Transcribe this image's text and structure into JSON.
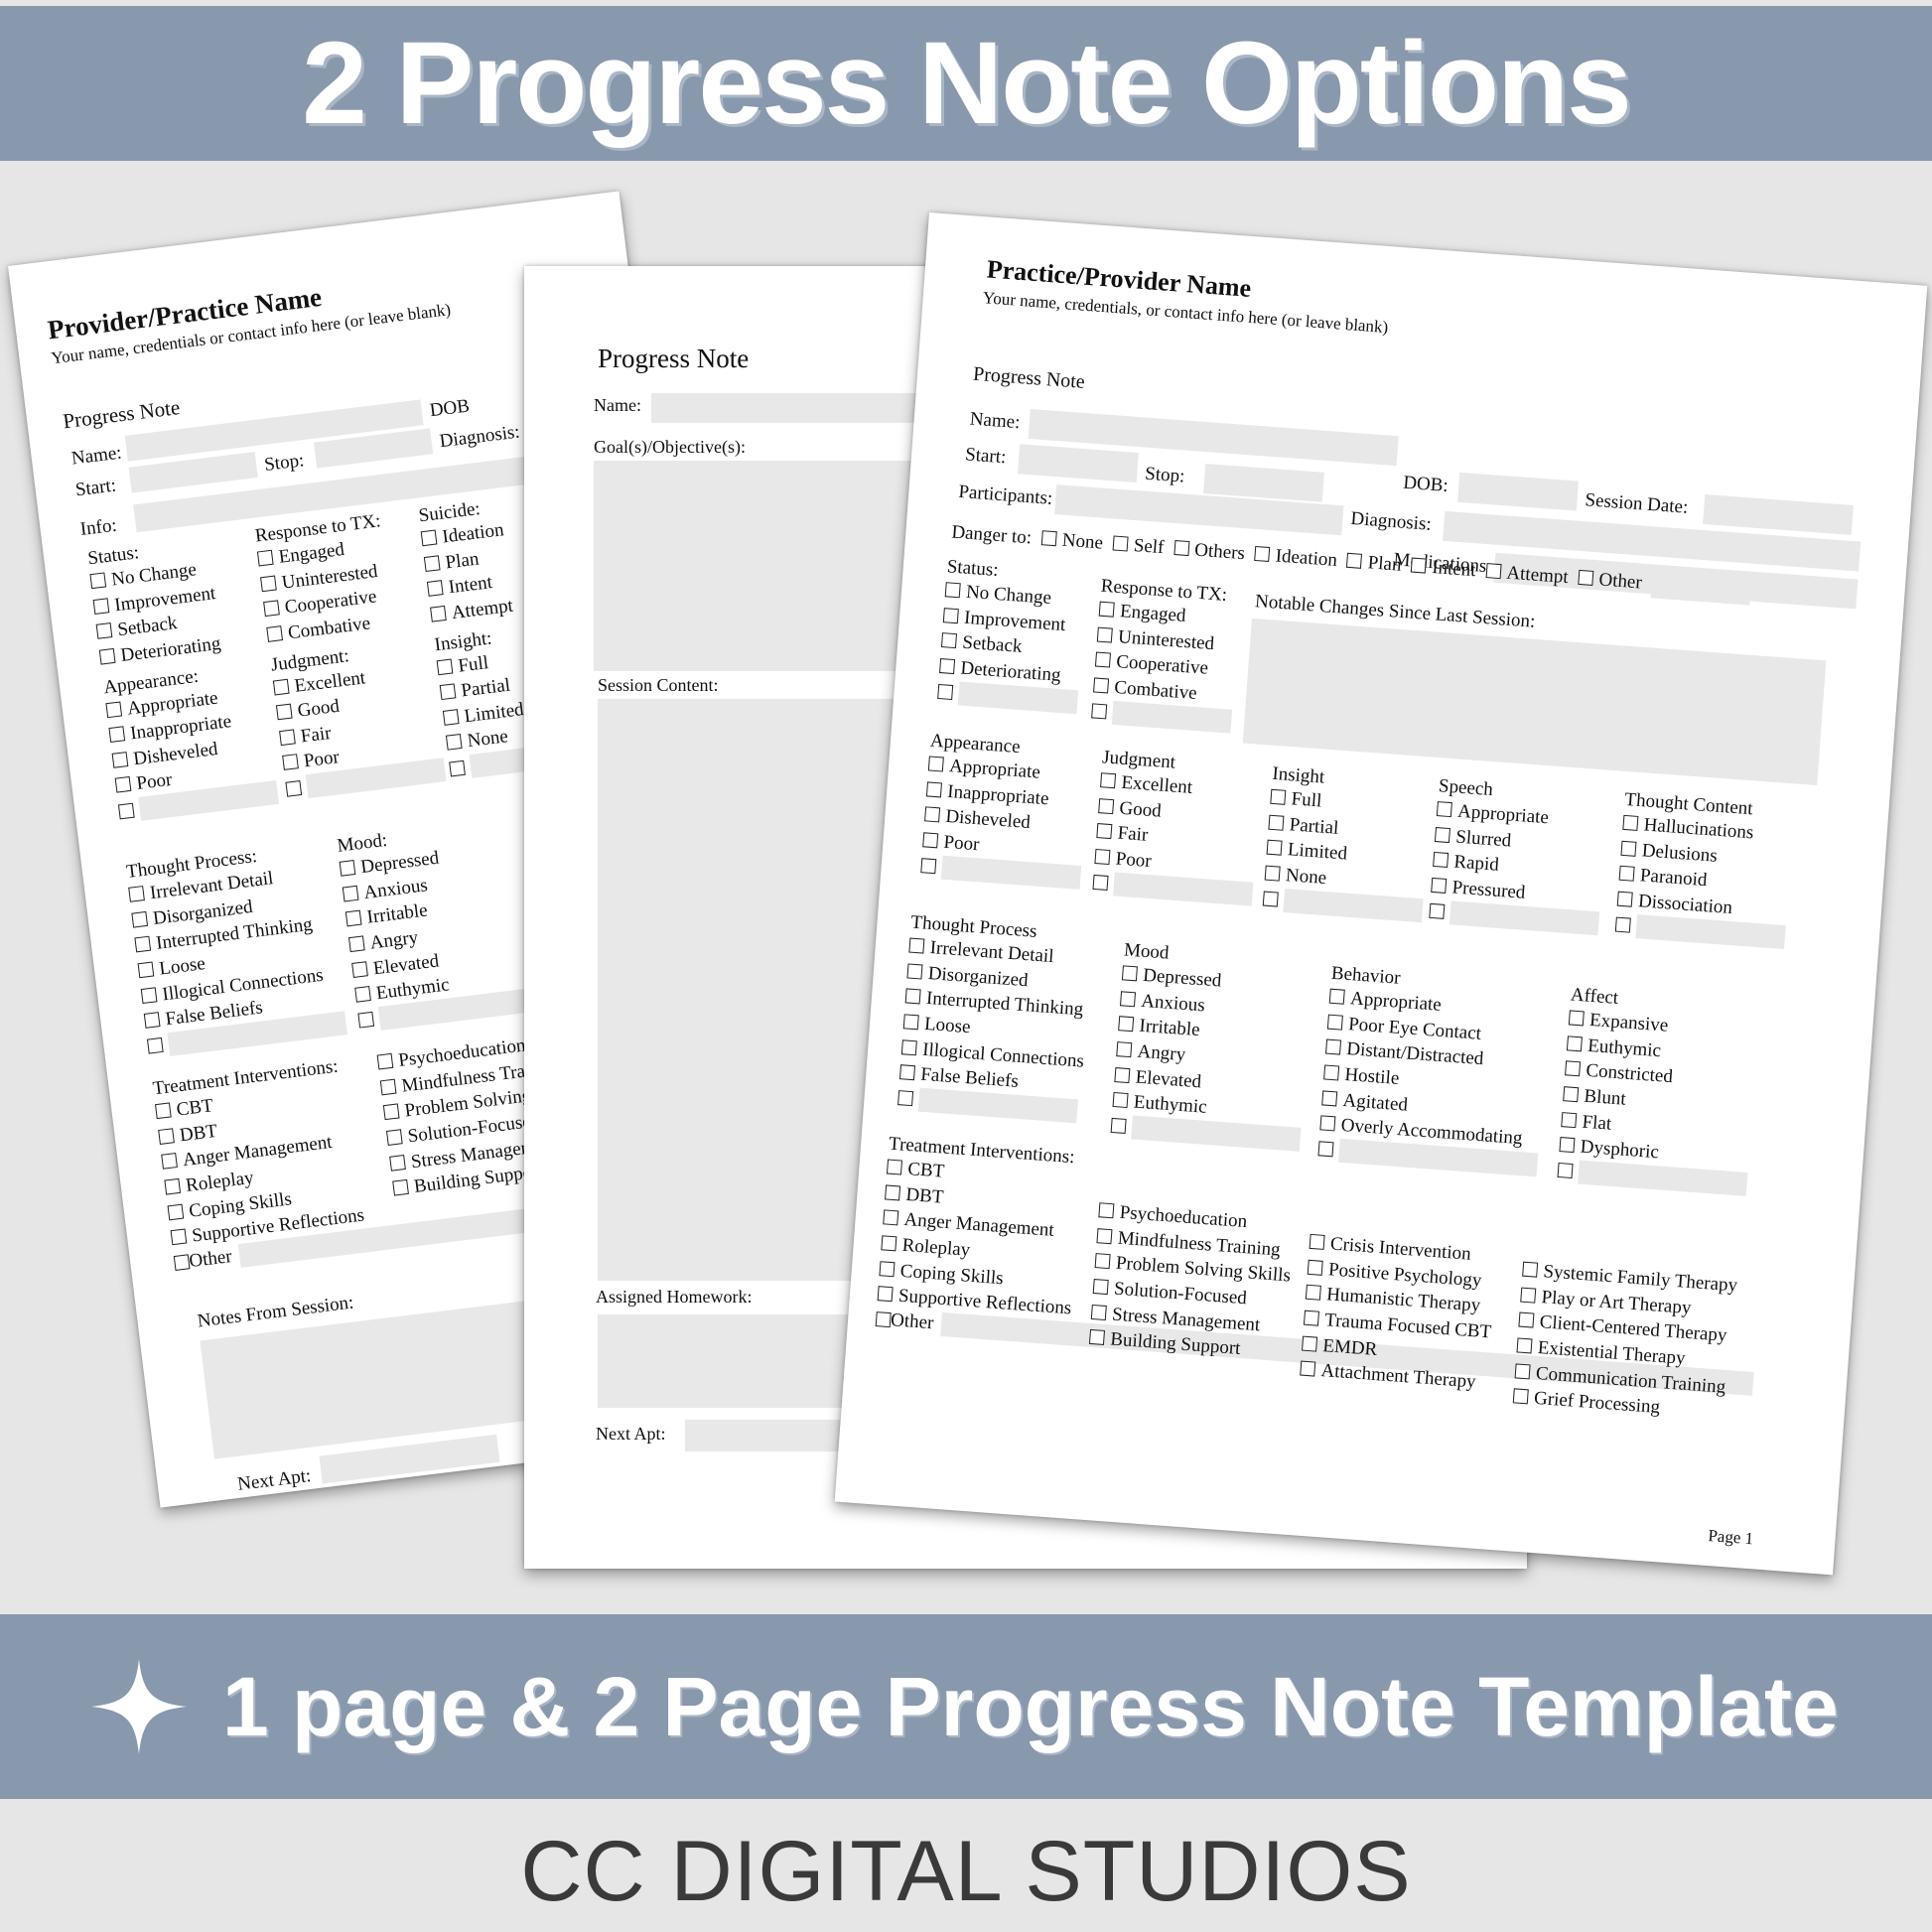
{
  "banner_top": {
    "title": "2 Progress Note Options"
  },
  "banner_bottom": {
    "icon": "sparkle-icon",
    "subtitle": "1 page & 2 Page Progress Note Template"
  },
  "brand": "CC DIGITAL STUDIOS",
  "colors": {
    "banner": "#8898ad",
    "background": "#e6e6e6",
    "field": "#e8e8e8"
  },
  "page_left": {
    "provider_name": "Provider/Practice Name",
    "provider_sub": "Your name, credentials or contact info here (or leave blank)",
    "form_title": "Progress Note",
    "name_label": "Name:",
    "dob_label": "DOB",
    "start_label": "Start:",
    "stop_label": "Stop:",
    "diagnosis_label": "Diagnosis:",
    "info_label": "Info:",
    "status": {
      "label": "Status:",
      "options": [
        "No Change",
        "Improvement",
        "Setback",
        "Deteriorating"
      ]
    },
    "response": {
      "label": "Response to TX:",
      "options": [
        "Engaged",
        "Uninterested",
        "Cooperative",
        "Combative"
      ]
    },
    "suicide": {
      "label": "Suicide:",
      "options": [
        "Ideation",
        "Plan",
        "Intent",
        "Attempt"
      ]
    },
    "appearance": {
      "label": "Appearance:",
      "options": [
        "Appropriate",
        "Inappropriate",
        "Disheveled",
        "Poor"
      ]
    },
    "judgment": {
      "label": "Judgment:",
      "options": [
        "Excellent",
        "Good",
        "Fair",
        "Poor"
      ]
    },
    "insight": {
      "label": "Insight:",
      "options": [
        "Full",
        "Partial",
        "Limited",
        "None"
      ]
    },
    "thought_process": {
      "label": "Thought Process:",
      "options": [
        "Irrelevant Detail",
        "Disorganized",
        "Interrupted Thinking",
        "Loose",
        "Illogical Connections",
        "False Beliefs"
      ]
    },
    "mood": {
      "label": "Mood:",
      "options": [
        "Depressed",
        "Anxious",
        "Irritable",
        "Angry",
        "Elevated",
        "Euthymic"
      ]
    },
    "treatment": {
      "label": "Treatment Interventions:",
      "col1": [
        "CBT",
        "DBT",
        "Anger Management",
        "Roleplay",
        "Coping Skills",
        "Supportive Reflections"
      ],
      "col2": [
        "Psychoeducation",
        "Mindfulness Training",
        "Problem Solving Skills",
        "Solution-Focused",
        "Stress Management",
        "Building Support"
      ],
      "other_label": "Other"
    },
    "notes_label": "Notes From Session:",
    "next_apt_label": "Next Apt:"
  },
  "page_middle": {
    "form_title": "Progress Note",
    "name_label": "Name:",
    "goals_label": "Goal(s)/Objective(s):",
    "session_content_label": "Session Content:",
    "homework_label": "Assigned Homework:",
    "next_apt_label": "Next Apt:"
  },
  "page_front": {
    "provider_name": "Practice/Provider Name",
    "provider_sub": "Your name, credentials, or contact info here (or leave blank)",
    "form_title": "Progress Note",
    "name_label": "Name:",
    "start_label": "Start:",
    "stop_label": "Stop:",
    "dob_label": "DOB:",
    "session_date_label": "Session Date:",
    "participants_label": "Participants:",
    "diagnosis_label": "Diagnosis:",
    "medications_label": "Medications:",
    "danger": {
      "label": "Danger to:",
      "options": [
        "None",
        "Self",
        "Others",
        "Ideation",
        "Plan",
        "Intent",
        "Attempt",
        "Other"
      ]
    },
    "status": {
      "label": "Status:",
      "options": [
        "No Change",
        "Improvement",
        "Setback",
        "Deteriorating"
      ]
    },
    "response": {
      "label": "Response to TX:",
      "options": [
        "Engaged",
        "Uninterested",
        "Cooperative",
        "Combative"
      ]
    },
    "notable_label": "Notable Changes Since Last Session:",
    "appearance": {
      "label": "Appearance",
      "options": [
        "Appropriate",
        "Inappropriate",
        "Disheveled",
        "Poor"
      ]
    },
    "judgment": {
      "label": "Judgment",
      "options": [
        "Excellent",
        "Good",
        "Fair",
        "Poor"
      ]
    },
    "insight": {
      "label": "Insight",
      "options": [
        "Full",
        "Partial",
        "Limited",
        "None"
      ]
    },
    "speech": {
      "label": "Speech",
      "options": [
        "Appropriate",
        "Slurred",
        "Rapid",
        "Pressured"
      ]
    },
    "thought_content": {
      "label": "Thought Content",
      "options": [
        "Hallucinations",
        "Delusions",
        "Paranoid",
        "Dissociation"
      ]
    },
    "thought_process": {
      "label": "Thought Process",
      "options": [
        "Irrelevant Detail",
        "Disorganized",
        "Interrupted Thinking",
        "Loose",
        "Illogical Connections",
        "False Beliefs"
      ]
    },
    "mood": {
      "label": "Mood",
      "options": [
        "Depressed",
        "Anxious",
        "Irritable",
        "Angry",
        "Elevated",
        "Euthymic"
      ]
    },
    "behavior": {
      "label": "Behavior",
      "options": [
        "Appropriate",
        "Poor Eye Contact",
        "Distant/Distracted",
        "Hostile",
        "Agitated",
        "Overly Accommodating"
      ]
    },
    "affect": {
      "label": "Affect",
      "options": [
        "Expansive",
        "Euthymic",
        "Constricted",
        "Blunt",
        "Flat",
        "Dysphoric"
      ]
    },
    "treatment": {
      "label": "Treatment Interventions:",
      "col1": [
        "CBT",
        "DBT",
        "Anger Management",
        "Roleplay",
        "Coping Skills",
        "Supportive Reflections"
      ],
      "col2": [
        "Psychoeducation",
        "Mindfulness Training",
        "Problem Solving Skills",
        "Solution-Focused",
        "Stress Management",
        "Building Support"
      ],
      "col3": [
        "Crisis Intervention",
        "Positive Psychology",
        "Humanistic Therapy",
        "Trauma Focused CBT",
        "EMDR",
        "Attachment Therapy"
      ],
      "col4": [
        "Systemic Family Therapy",
        "Play or Art Therapy",
        "Client-Centered Therapy",
        "Existential Therapy",
        "Communication Training",
        "Grief Processing"
      ],
      "other_label": "Other"
    },
    "page_number": "Page 1"
  }
}
